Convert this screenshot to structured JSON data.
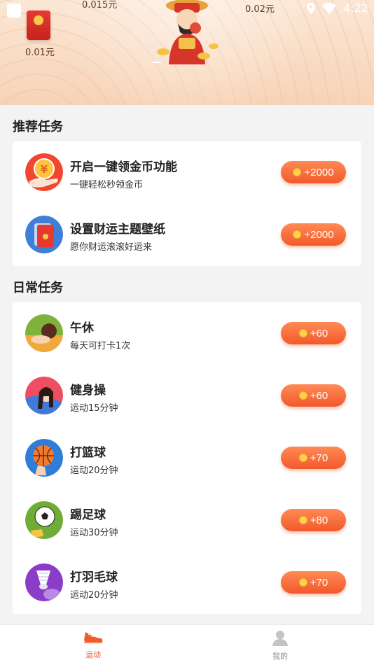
{
  "status_bar": {
    "time": "4:22"
  },
  "header": {
    "amounts": [
      "0.015元",
      "0.02元",
      "0.01元"
    ]
  },
  "recommended": {
    "title": "推荐任务",
    "tasks": [
      {
        "name": "开启一键领金币功能",
        "desc": "一键轻松秒领金币",
        "reward": "+2000",
        "icon": "yuan-coin-hand-icon"
      },
      {
        "name": "设置财运主题壁纸",
        "desc": "愿你财运滚滚好运来",
        "reward": "+2000",
        "icon": "red-packet-wallpaper-icon"
      }
    ]
  },
  "daily": {
    "title": "日常任务",
    "tasks": [
      {
        "name": "午休",
        "desc": "每天可打卡1次",
        "reward": "+60",
        "icon": "nap-icon"
      },
      {
        "name": "健身操",
        "desc": "运动15分钟",
        "reward": "+60",
        "icon": "aerobics-icon"
      },
      {
        "name": "打篮球",
        "desc": "运动20分钟",
        "reward": "+70",
        "icon": "basketball-icon"
      },
      {
        "name": "踢足球",
        "desc": "运动30分钟",
        "reward": "+80",
        "icon": "football-icon"
      },
      {
        "name": "打羽毛球",
        "desc": "运动20分钟",
        "reward": "+70",
        "icon": "badminton-icon"
      }
    ]
  },
  "bottom_nav": {
    "items": [
      {
        "label": "运动",
        "icon": "sneaker-icon",
        "active": true
      },
      {
        "label": "我的",
        "icon": "person-icon",
        "active": false
      }
    ]
  },
  "colors": {
    "accent": "#f05a2c",
    "button_top": "#ff8a55",
    "button_bottom": "#f2592b"
  }
}
